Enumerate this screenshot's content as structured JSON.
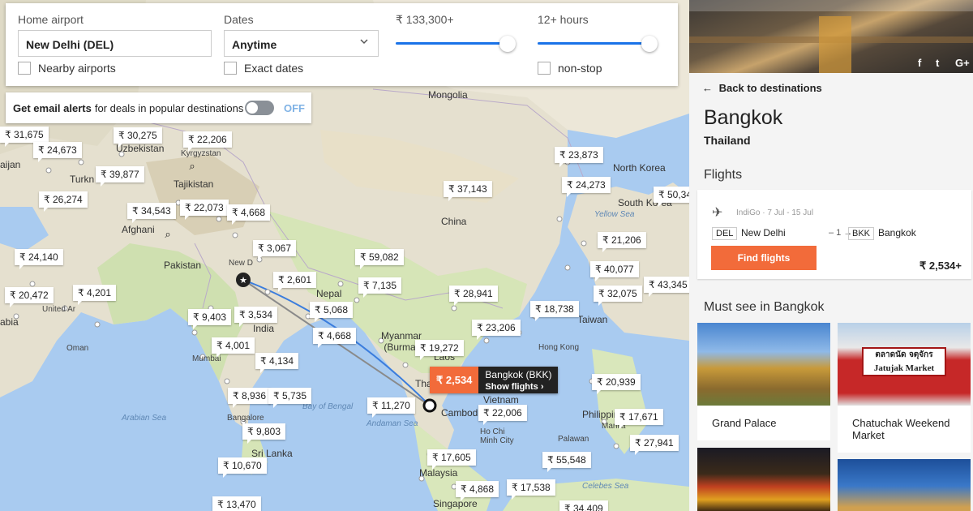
{
  "filters": {
    "home_label": "Home airport",
    "home_value": "New Delhi (DEL)",
    "nearby_label": "Nearby airports",
    "dates_label": "Dates",
    "dates_value": "Anytime",
    "exact_label": "Exact dates",
    "price_label": "₹ 133,300+",
    "price_level": 1.0,
    "duration_label": "12+ hours",
    "duration_level": 1.0,
    "nonstop_label": "non-stop"
  },
  "alerts": {
    "bold": "Get email alerts",
    "rest": "for deals in popular destinations",
    "state": "OFF"
  },
  "map": {
    "places": [
      "Mongolia",
      "Uzbekistan",
      "Kyrgyzstan",
      "Turkn",
      "Tajikistan",
      "Afghani",
      "Pakistan",
      "New D",
      "North Korea",
      "South Korea",
      "China",
      "Nepal",
      "India",
      "Myanmar (Burma)",
      "Laos",
      "Thai",
      "Hong Kong",
      "Taiwan",
      "Philippines",
      "Cambod",
      "Vietnam",
      "Sri Lanka",
      "Malaysia",
      "Singapore",
      "Oman",
      "Mumbai",
      "Bangalore",
      "Philippines",
      "Manila",
      "Palawan",
      "Ho Chi Minh City",
      "Yellow Sea",
      "Arabian Sea",
      "Bay of Bengal",
      "Andaman Sea",
      "Celebes Sea",
      "aijan",
      "abia",
      "United Ar"
    ],
    "prices": [
      "₹ 31,675",
      "₹ 24,673",
      "₹ 30,275",
      "₹ 22,206",
      "₹ 39,877",
      "₹ 26,274",
      "₹ 34,543",
      "₹ 22,073",
      "₹ 4,668",
      "₹ 3,067",
      "₹ 24,140",
      "₹ 20,472",
      "₹ 4,201",
      "₹ 2,601",
      "₹ 9,403",
      "₹ 3,534",
      "₹ 5,068",
      "₹ 7,135",
      "₹ 59,082",
      "₹ 37,143",
      "₹ 23,873",
      "₹ 24,273",
      "₹ 50,34",
      "₹ 21,206",
      "₹ 40,077",
      "₹ 32,075",
      "₹ 43,345",
      "₹ 28,941",
      "₹ 18,738",
      "₹ 23,206",
      "₹ 4,668",
      "₹ 4,001",
      "₹ 4,134",
      "₹ 19,272",
      "₹ 20,939",
      "₹ 8,936",
      "₹ 5,735",
      "₹ 11,270",
      "₹ 22,006",
      "₹ 17,671",
      "₹ 9,803",
      "₹ 27,941",
      "₹ 10,670",
      "₹ 17,605",
      "₹ 55,548",
      "₹ 4,868",
      "₹ 17,538",
      "₹ 13,470",
      "₹ 34,409"
    ],
    "popup": {
      "price": "₹ 2,534",
      "name": "Bangkok (BKK)",
      "action": "Show flights ›"
    }
  },
  "panel": {
    "social": [
      "f",
      "t",
      "G+"
    ],
    "back": "Back to destinations",
    "city": "Bangkok",
    "country": "Thailand",
    "flights_title": "Flights",
    "airline": "IndiGo · 7 Jul - 15 Jul",
    "from_code": "DEL",
    "from_city": "New Delhi",
    "stops": "– 1 →",
    "to_code": "BKK",
    "to_city": "Bangkok",
    "find_label": "Find flights",
    "price": "₹ 2,534+",
    "must_see_title": "Must see in Bangkok",
    "sights": [
      "Grand Palace",
      "Chatuchak Weekend Market"
    ],
    "sign_line1": "ตลาดนัด จตุจักร",
    "sign_line2": "Jatujak Market"
  },
  "colors": {
    "accent": "#f26b3a",
    "slider": "#1a73e8",
    "route": "#3b7ddd"
  }
}
